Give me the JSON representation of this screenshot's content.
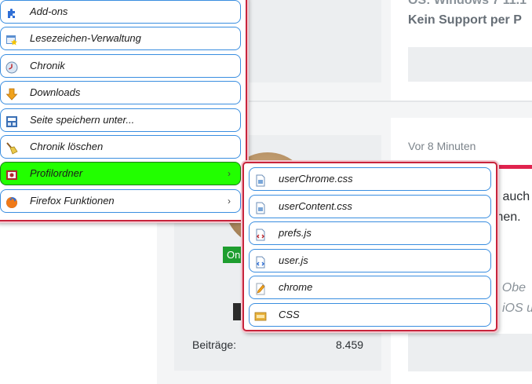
{
  "background": {
    "system_line1": "OS: Windows 7 11.1",
    "system_line2": "Kein Support per P",
    "time_ago": "Vor 8 Minuten",
    "post_line1": "s auch",
    "post_line2": "men.",
    "signature_line1": "r Obe",
    "signature_line2": "iOS u",
    "online_label": "On",
    "posts_label": "Beiträge:",
    "posts_value": "8.459"
  },
  "main_menu": {
    "items": [
      {
        "label": "Add-ons",
        "icon": "puzzle-icon",
        "has_submenu": false
      },
      {
        "label": "Lesezeichen-Verwaltung",
        "icon": "bookmarks-star-icon",
        "has_submenu": false
      },
      {
        "label": "Chronik",
        "icon": "clock-icon",
        "has_submenu": false
      },
      {
        "label": "Downloads",
        "icon": "download-arrow-icon",
        "has_submenu": false
      },
      {
        "label": "Seite speichern unter...",
        "icon": "save-page-icon",
        "has_submenu": false
      },
      {
        "label": "Chronik löschen",
        "icon": "broom-icon",
        "has_submenu": false
      },
      {
        "label": "Profilordner",
        "icon": "profile-folder-icon",
        "has_submenu": true
      },
      {
        "label": "Firefox Funktionen",
        "icon": "firefox-icon",
        "has_submenu": true
      }
    ],
    "arrow_glyph": "›"
  },
  "submenu": {
    "items": [
      {
        "label": "userChrome.css",
        "icon": "css-file-icon"
      },
      {
        "label": "userContent.css",
        "icon": "css-file-icon"
      },
      {
        "label": "prefs.js",
        "icon": "js-file-icon"
      },
      {
        "label": "user.js",
        "icon": "js-file-icon"
      },
      {
        "label": "chrome",
        "icon": "pencil-file-icon"
      },
      {
        "label": "CSS",
        "icon": "css-folder-icon"
      }
    ]
  },
  "colors": {
    "highlight": "#22ff00",
    "menu_border": "#c8243c",
    "item_border": "#3a8ee0",
    "accent_red": "#e0234e",
    "online_green": "#1e9e2f"
  }
}
